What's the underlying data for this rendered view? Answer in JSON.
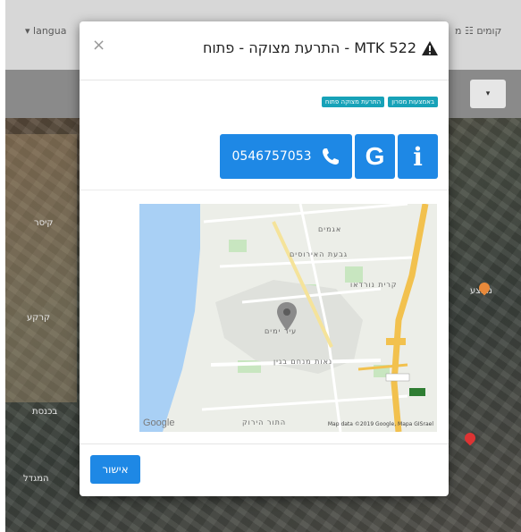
{
  "background": {
    "language_link": "▾ langua",
    "nav_menu": "קומים ☷ מ",
    "select_arrow": "▾",
    "map_labels": [
      "קיסר",
      "קרקע",
      "בכנסת",
      "המגדל",
      "מבצע"
    ]
  },
  "modal": {
    "title": "MTK 522 - התרעת מצוקה - פתוח",
    "close_label": "×",
    "badges": [
      "באמצעות מסרון",
      "התרעת מצוקה פתוח"
    ],
    "phone": "0546757053",
    "google_label": "G",
    "info_label": "i",
    "ok_label": "אישור"
  },
  "map": {
    "labels": [
      "אגמים",
      "גבעת האירוסים",
      "קרית נורדאו",
      "עיר ימים",
      "נאות מנחם בגין",
      "התור הירוק"
    ],
    "google_label": "Google",
    "attribution": "Map data ©2019 Google, Mapa GISrael"
  },
  "colors": {
    "primary": "#1e88e5",
    "badge": "#17a2b8",
    "sea": "#a9d0f5",
    "highway": "#f2c14e",
    "park": "#c8e6c0"
  }
}
